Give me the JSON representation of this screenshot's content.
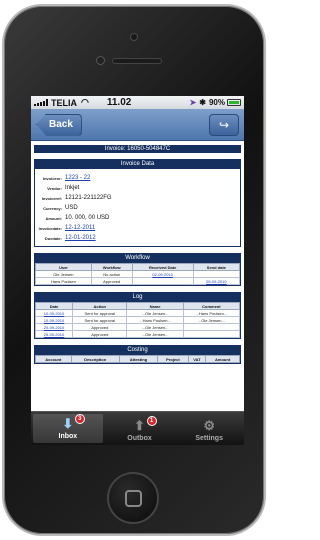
{
  "status": {
    "carrier": "TELIA",
    "time": "11.02",
    "battery": "90%"
  },
  "nav": {
    "back_label": "Back"
  },
  "invoice_title": "Invoice: 16050-504847C",
  "invoice_data": {
    "heading": "Invoice Data",
    "rows": [
      {
        "label": "Invoicenr:",
        "value": "1223 - 22",
        "link": true
      },
      {
        "label": "Vendor:",
        "value": "Inkjet",
        "link": false
      },
      {
        "label": "Invoiceref:",
        "value": "12121-221122FG",
        "link": false
      },
      {
        "label": "Currency:",
        "value": "USD",
        "link": false
      },
      {
        "label": "Amount:",
        "value": "10. 000, 00 USD",
        "link": false
      },
      {
        "label": "Invoicedate:",
        "value": "12-12-2011",
        "link": true
      },
      {
        "label": "Duedate:",
        "value": "12-01-2012",
        "link": true
      }
    ]
  },
  "workflow": {
    "heading": "Workflow",
    "columns": [
      "User",
      "Workflow",
      "Received Date",
      "Send date"
    ],
    "rows": [
      [
        "Ole Jensen",
        "No action",
        "02-09-2010",
        ""
      ],
      [
        "Hans Poulsen",
        "Approved",
        "",
        "05-09-2010"
      ]
    ]
  },
  "log": {
    "heading": "Log",
    "columns": [
      "Date",
      "Action",
      "Name",
      "Comment"
    ],
    "rows": [
      [
        "10-09-2010",
        "Sent for approval",
        "...Ole Jensen...",
        "...Hans Poulsen..."
      ],
      [
        "10-09-2010",
        "Sent for approval",
        "...Hans Poulsen...",
        "...Ole Jensen..."
      ],
      [
        "20-09-2010",
        "Approved",
        "...Ole Jensen...",
        ""
      ],
      [
        "25-09-2010",
        "Approved",
        "...Ole Jensen...",
        ""
      ]
    ]
  },
  "costing": {
    "heading": "Costing",
    "columns": [
      "Account",
      "Description",
      "Attesting",
      "Project",
      "VAT",
      "Amount"
    ]
  },
  "tabs": [
    {
      "label": "Inbox",
      "badge": "3",
      "active": true
    },
    {
      "label": "Outbox",
      "badge": "1",
      "active": false
    },
    {
      "label": "Settings",
      "badge": "",
      "active": false
    }
  ]
}
